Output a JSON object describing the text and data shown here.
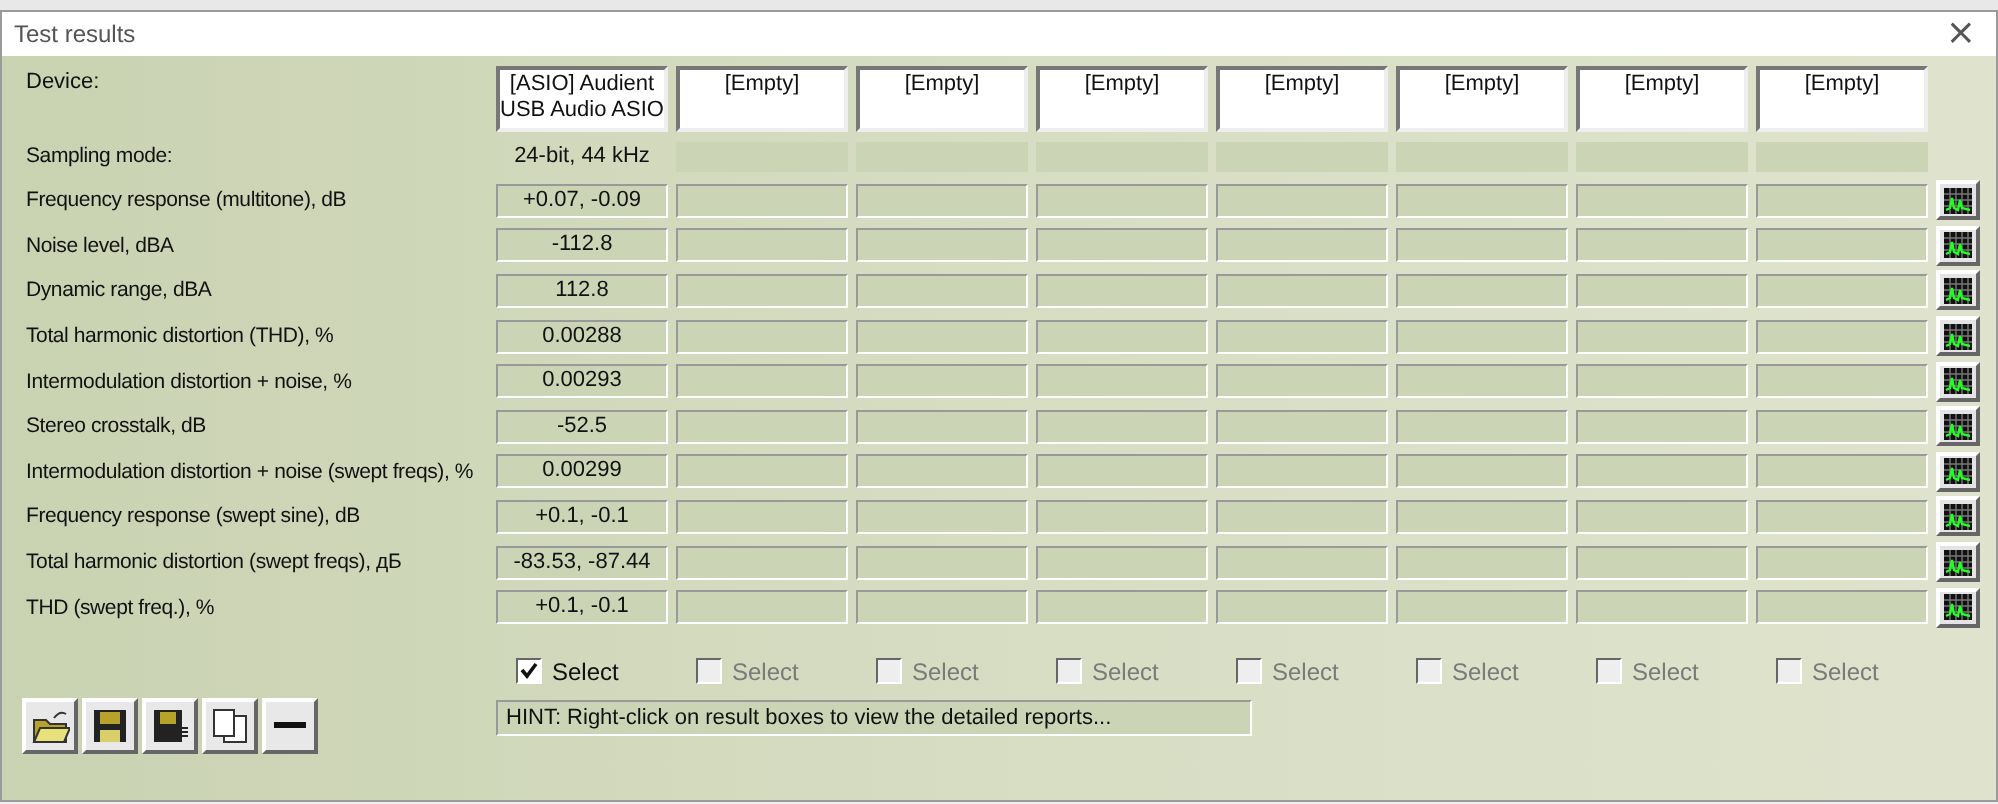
{
  "window": {
    "title": "Test results",
    "close": "×"
  },
  "device_label": "Device:",
  "devices": [
    "[ASIO] Audient USB Audio ASIO",
    "[Empty]",
    "[Empty]",
    "[Empty]",
    "[Empty]",
    "[Empty]",
    "[Empty]",
    "[Empty]"
  ],
  "sampling": {
    "label": "Sampling mode:",
    "value": "24-bit, 44 kHz"
  },
  "rows": [
    {
      "label": "Frequency response (multitone), dB",
      "value": "+0.07, -0.09"
    },
    {
      "label": "Noise level, dBA",
      "value": "-112.8"
    },
    {
      "label": "Dynamic range, dBA",
      "value": "112.8"
    },
    {
      "label": "Total harmonic distortion (THD), %",
      "value": "0.00288"
    },
    {
      "label": "Intermodulation distortion + noise, %",
      "value": "0.00293"
    },
    {
      "label": "Stereo crosstalk, dB",
      "value": "-52.5"
    },
    {
      "label": "Intermodulation distortion + noise (swept freqs), %",
      "value": "0.00299"
    },
    {
      "label": "Frequency response (swept sine), dB",
      "value": "+0.1, -0.1"
    },
    {
      "label": "Total harmonic distortion (swept freqs), дБ",
      "value": "-83.53, -87.44"
    },
    {
      "label": "THD (swept freq.), %",
      "value": "+0.1, -0.1"
    }
  ],
  "selects": [
    {
      "label": "Select",
      "checked": true,
      "disabled": false
    },
    {
      "label": "Select",
      "checked": false,
      "disabled": true
    },
    {
      "label": "Select",
      "checked": false,
      "disabled": true
    },
    {
      "label": "Select",
      "checked": false,
      "disabled": true
    },
    {
      "label": "Select",
      "checked": false,
      "disabled": true
    },
    {
      "label": "Select",
      "checked": false,
      "disabled": true
    },
    {
      "label": "Select",
      "checked": false,
      "disabled": true
    },
    {
      "label": "Select",
      "checked": false,
      "disabled": true
    }
  ],
  "hint": "HINT: Right-click on result boxes to view the detailed reports..."
}
